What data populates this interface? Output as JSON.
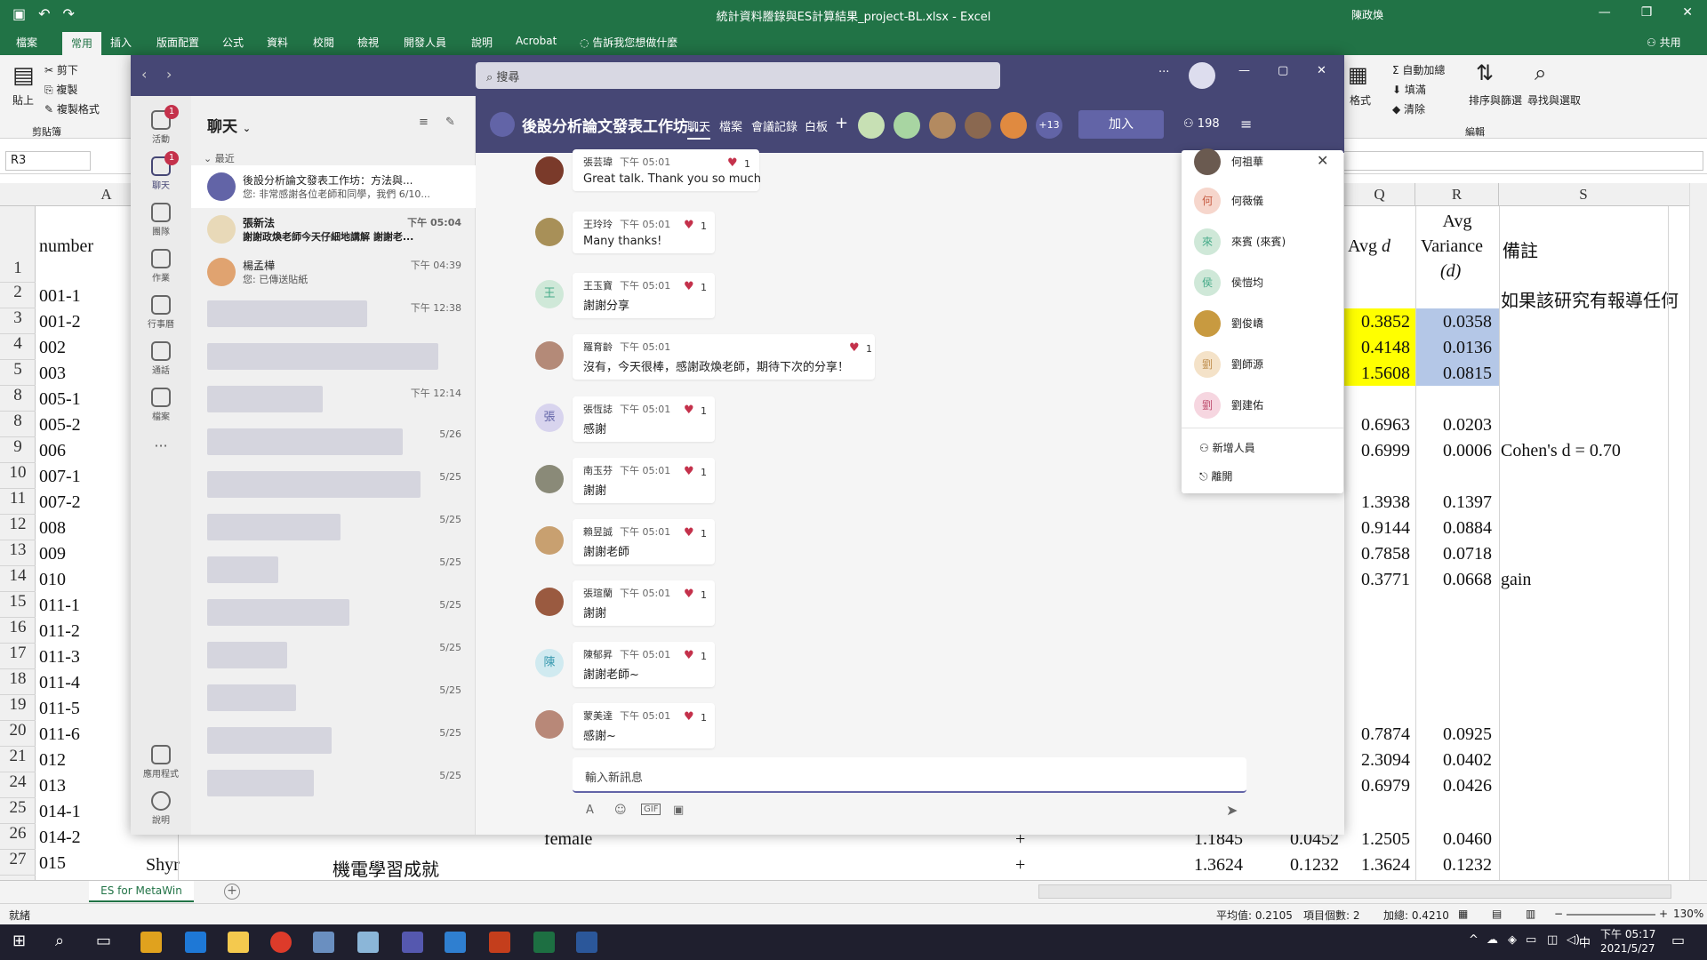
{
  "excel": {
    "title": "統計資料謄錄與ES計算結果_project-BL.xlsx  -  Excel",
    "user": "陳政煥",
    "tabs": [
      "檔案",
      "常用",
      "插入",
      "版面配置",
      "公式",
      "資料",
      "校閱",
      "檢視",
      "開發人員",
      "說明",
      "Acrobat"
    ],
    "tell_me": "告訴我您想做什麼",
    "share": "共用",
    "ribbon": {
      "paste": "貼上",
      "cut": "剪下",
      "copy": "複製",
      "format_painter": "複製格式",
      "clipboard": "剪貼簿",
      "autosum": "自動加總",
      "fill": "填滿",
      "clear": "清除",
      "sort": "排序與篩選",
      "find": "尋找與選取",
      "editing": "編輯",
      "format": "格式"
    },
    "name_box": "R3",
    "columns": {
      "a": "A",
      "q": "Q",
      "r": "R",
      "s": "S"
    },
    "headers": {
      "number": "number",
      "avg_d": "Avg",
      "avg_d_sym": "d",
      "avg_var": "Avg",
      "avg_var2": "Variance",
      "avg_var_sym": "(d)",
      "note": "備註"
    },
    "rows": [
      {
        "r": "1",
        "a": ""
      },
      {
        "r": "2",
        "a": "001-1"
      },
      {
        "r": "3",
        "a": "001-2"
      },
      {
        "r": "4",
        "a": "002"
      },
      {
        "r": "5",
        "a": "003"
      },
      {
        "r": "8",
        "a": "005-1"
      },
      {
        "r": "8",
        "a": "005-2"
      },
      {
        "r": "9",
        "a": "006"
      },
      {
        "r": "10",
        "a": "007-1"
      },
      {
        "r": "11",
        "a": "007-2"
      },
      {
        "r": "12",
        "a": "008"
      },
      {
        "r": "13",
        "a": "009"
      },
      {
        "r": "14",
        "a": "010"
      },
      {
        "r": "15",
        "a": "011-1"
      },
      {
        "r": "16",
        "a": "011-2"
      },
      {
        "r": "17",
        "a": "011-3"
      },
      {
        "r": "18",
        "a": "011-4"
      },
      {
        "r": "19",
        "a": "011-5"
      },
      {
        "r": "20",
        "a": "011-6"
      },
      {
        "r": "21",
        "a": "012"
      },
      {
        "r": "24",
        "a": "013"
      },
      {
        "r": "25",
        "a": "014-1"
      },
      {
        "r": "26",
        "a": "014-2"
      },
      {
        "r": "27",
        "a": "015"
      }
    ],
    "qr": {
      "r2s": "如果該研究有報導任何",
      "r3q": "0.3852",
      "r3r": "0.0358",
      "r4q": "0.4148",
      "r4r": "0.0136",
      "r5q": "1.5608",
      "r5r": "0.0815",
      "r8q": "0.6963",
      "r8r": "0.0203",
      "r9q": "0.6999",
      "r9r": "0.0006",
      "r9s": "Cohen's d = 0.70",
      "r11q": "1.3938",
      "r11r": "0.1397",
      "r12q": "0.9144",
      "r12r": "0.0884",
      "r13q": "0.7858",
      "r13r": "0.0718",
      "r14q": "0.3771",
      "r14r": "0.0668",
      "r14s": "gain",
      "r20q": "0.7874",
      "r20r": "0.0925",
      "r21q": "2.3094",
      "r21r": "0.0402",
      "r24q": "0.6979",
      "r24r": "0.0426",
      "r26b": "female",
      "r26e": "+",
      "r26f": "1.1845",
      "r26g": "0.0452",
      "r26q": "1.2505",
      "r26r": "0.0460",
      "r27a2": "Shyr",
      "r27b": "機電學習成就",
      "r27e": "+",
      "r27f": "1.3624",
      "r27g": "0.1232",
      "r27q": "1.3624",
      "r27r": "0.1232"
    },
    "sheet_tab": "ES for MetaWin",
    "status": {
      "ready": "就緒",
      "avg": "平均值: 0.2105",
      "count": "項目個數: 2",
      "sum": "加總: 0.4210",
      "zoom": "130%"
    },
    "highlight": {
      "yellow": "#ffff00",
      "blue": "#b4c7e7"
    }
  },
  "teams": {
    "search_placeholder": "搜尋",
    "rail": [
      "活動",
      "聊天",
      "團隊",
      "作業",
      "行事曆",
      "通話",
      "檔案",
      "應用程式",
      "說明"
    ],
    "rail_badges": {
      "activity": "1",
      "chat": "1"
    },
    "list_title": "聊天",
    "recent": "最近",
    "chats": [
      {
        "name": "後設分析論文發表工作坊：方法與...",
        "preview": "您: 非常感謝各位老師和同學，我們 6/10...",
        "time": ""
      },
      {
        "name": "張新法",
        "preview": "謝謝政煥老師今天仔細地講解 謝謝老...",
        "time": "下午 05:04"
      },
      {
        "name": "楊孟樺",
        "preview": "您: 已傳送貼紙",
        "time": "下午 04:39"
      },
      {
        "name": "",
        "preview": "",
        "time": "下午 12:38"
      },
      {
        "name": "",
        "preview": "",
        "time": ""
      },
      {
        "name": "",
        "preview": "",
        "time": "下午 12:14"
      },
      {
        "name": "",
        "preview": "",
        "time": "5/26"
      },
      {
        "name": "",
        "preview": "",
        "time": "5/25"
      },
      {
        "name": "",
        "preview": "",
        "time": "5/25"
      },
      {
        "name": "",
        "preview": "",
        "time": "5/25"
      },
      {
        "name": "",
        "preview": "",
        "time": "5/25"
      },
      {
        "name": "",
        "preview": "",
        "time": "5/25"
      },
      {
        "name": "",
        "preview": "",
        "time": "5/25"
      },
      {
        "name": "",
        "preview": "",
        "time": "5/25"
      },
      {
        "name": "",
        "preview": "",
        "time": "5/25"
      }
    ],
    "meeting_title": "後設分析論文發表工作坊...",
    "meeting_tabs": [
      "聊天",
      "檔案",
      "會議記錄",
      "白板"
    ],
    "participants_more": "+13",
    "join": "加入",
    "participant_count": "198",
    "messages": [
      {
        "name": "張芸瑋",
        "time": "下午 05:01",
        "text": "Great talk. Thank you so much",
        "likes": "1"
      },
      {
        "name": "王玲玲",
        "time": "下午 05:01",
        "text": "Many thanks!",
        "likes": "1"
      },
      {
        "name": "王玉寶",
        "time": "下午 05:01",
        "text": "謝謝分享",
        "likes": "1"
      },
      {
        "name": "羅育齡",
        "time": "下午 05:01",
        "text": "沒有，今天很棒，感謝政煥老師，期待下次的分享！",
        "likes": "1"
      },
      {
        "name": "張恆誌",
        "time": "下午 05:01",
        "text": "感謝",
        "likes": "1"
      },
      {
        "name": "南玉芬",
        "time": "下午 05:01",
        "text": "謝謝",
        "likes": "1"
      },
      {
        "name": "賴昱誠",
        "time": "下午 05:01",
        "text": "謝謝老師",
        "likes": "1"
      },
      {
        "name": "張瑄蘭",
        "time": "下午 05:01",
        "text": "謝謝",
        "likes": "1"
      },
      {
        "name": "陳郁昇",
        "time": "下午 05:01",
        "text": "謝謝老師~",
        "likes": "1"
      },
      {
        "name": "蒙美達",
        "time": "下午 05:01",
        "text": "感謝~",
        "likes": "1"
      }
    ],
    "compose_placeholder": "輸入新訊息",
    "people": [
      "何祖華",
      "何薇儀",
      "來賓 (來賓)",
      "侯愷均",
      "劉俊嶠",
      "劉師源",
      "劉建佑"
    ],
    "add_people": "新增人員",
    "leave": "離開",
    "accent": "#464775",
    "join_color": "#6264a7"
  },
  "taskbar": {
    "time": "下午 05:17",
    "date": "2021/5/27",
    "lang": "中"
  }
}
